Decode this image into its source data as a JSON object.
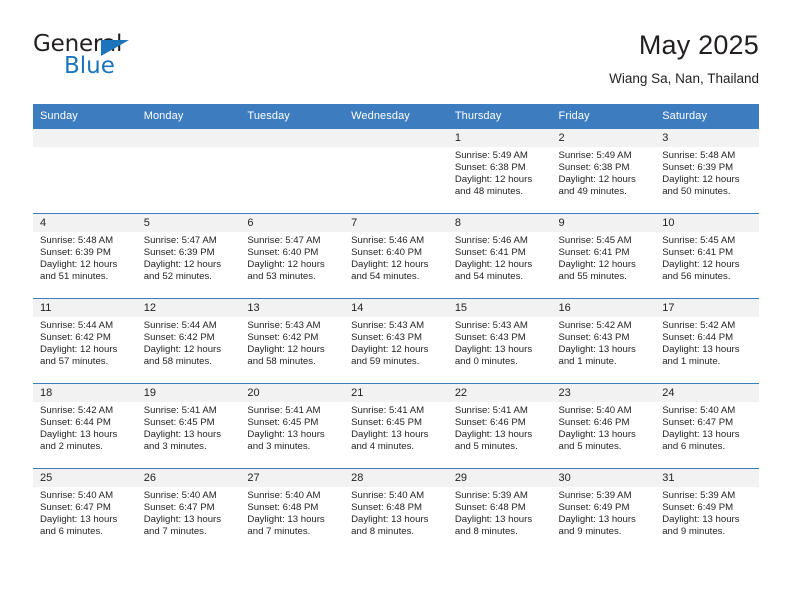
{
  "brand": {
    "logo_text_primary": "General",
    "logo_text_secondary": "Blue",
    "accent_color": "#1c75bc",
    "header_color": "#3c7cbf"
  },
  "header": {
    "title": "May 2025",
    "subtitle": "Wiang Sa, Nan, Thailand"
  },
  "calendar": {
    "weekday_headers": [
      "Sunday",
      "Monday",
      "Tuesday",
      "Wednesday",
      "Thursday",
      "Friday",
      "Saturday"
    ],
    "weeks": [
      [
        {
          "day": "",
          "empty": true
        },
        {
          "day": "",
          "empty": true
        },
        {
          "day": "",
          "empty": true
        },
        {
          "day": "",
          "empty": true
        },
        {
          "day": "1",
          "sunrise": "Sunrise: 5:49 AM",
          "sunset": "Sunset: 6:38 PM",
          "daylight": "Daylight: 12 hours and 48 minutes."
        },
        {
          "day": "2",
          "sunrise": "Sunrise: 5:49 AM",
          "sunset": "Sunset: 6:38 PM",
          "daylight": "Daylight: 12 hours and 49 minutes."
        },
        {
          "day": "3",
          "sunrise": "Sunrise: 5:48 AM",
          "sunset": "Sunset: 6:39 PM",
          "daylight": "Daylight: 12 hours and 50 minutes."
        }
      ],
      [
        {
          "day": "4",
          "sunrise": "Sunrise: 5:48 AM",
          "sunset": "Sunset: 6:39 PM",
          "daylight": "Daylight: 12 hours and 51 minutes."
        },
        {
          "day": "5",
          "sunrise": "Sunrise: 5:47 AM",
          "sunset": "Sunset: 6:39 PM",
          "daylight": "Daylight: 12 hours and 52 minutes."
        },
        {
          "day": "6",
          "sunrise": "Sunrise: 5:47 AM",
          "sunset": "Sunset: 6:40 PM",
          "daylight": "Daylight: 12 hours and 53 minutes."
        },
        {
          "day": "7",
          "sunrise": "Sunrise: 5:46 AM",
          "sunset": "Sunset: 6:40 PM",
          "daylight": "Daylight: 12 hours and 54 minutes."
        },
        {
          "day": "8",
          "sunrise": "Sunrise: 5:46 AM",
          "sunset": "Sunset: 6:41 PM",
          "daylight": "Daylight: 12 hours and 54 minutes."
        },
        {
          "day": "9",
          "sunrise": "Sunrise: 5:45 AM",
          "sunset": "Sunset: 6:41 PM",
          "daylight": "Daylight: 12 hours and 55 minutes."
        },
        {
          "day": "10",
          "sunrise": "Sunrise: 5:45 AM",
          "sunset": "Sunset: 6:41 PM",
          "daylight": "Daylight: 12 hours and 56 minutes."
        }
      ],
      [
        {
          "day": "11",
          "sunrise": "Sunrise: 5:44 AM",
          "sunset": "Sunset: 6:42 PM",
          "daylight": "Daylight: 12 hours and 57 minutes."
        },
        {
          "day": "12",
          "sunrise": "Sunrise: 5:44 AM",
          "sunset": "Sunset: 6:42 PM",
          "daylight": "Daylight: 12 hours and 58 minutes."
        },
        {
          "day": "13",
          "sunrise": "Sunrise: 5:43 AM",
          "sunset": "Sunset: 6:42 PM",
          "daylight": "Daylight: 12 hours and 58 minutes."
        },
        {
          "day": "14",
          "sunrise": "Sunrise: 5:43 AM",
          "sunset": "Sunset: 6:43 PM",
          "daylight": "Daylight: 12 hours and 59 minutes."
        },
        {
          "day": "15",
          "sunrise": "Sunrise: 5:43 AM",
          "sunset": "Sunset: 6:43 PM",
          "daylight": "Daylight: 13 hours and 0 minutes."
        },
        {
          "day": "16",
          "sunrise": "Sunrise: 5:42 AM",
          "sunset": "Sunset: 6:43 PM",
          "daylight": "Daylight: 13 hours and 1 minute."
        },
        {
          "day": "17",
          "sunrise": "Sunrise: 5:42 AM",
          "sunset": "Sunset: 6:44 PM",
          "daylight": "Daylight: 13 hours and 1 minute."
        }
      ],
      [
        {
          "day": "18",
          "sunrise": "Sunrise: 5:42 AM",
          "sunset": "Sunset: 6:44 PM",
          "daylight": "Daylight: 13 hours and 2 minutes."
        },
        {
          "day": "19",
          "sunrise": "Sunrise: 5:41 AM",
          "sunset": "Sunset: 6:45 PM",
          "daylight": "Daylight: 13 hours and 3 minutes."
        },
        {
          "day": "20",
          "sunrise": "Sunrise: 5:41 AM",
          "sunset": "Sunset: 6:45 PM",
          "daylight": "Daylight: 13 hours and 3 minutes."
        },
        {
          "day": "21",
          "sunrise": "Sunrise: 5:41 AM",
          "sunset": "Sunset: 6:45 PM",
          "daylight": "Daylight: 13 hours and 4 minutes."
        },
        {
          "day": "22",
          "sunrise": "Sunrise: 5:41 AM",
          "sunset": "Sunset: 6:46 PM",
          "daylight": "Daylight: 13 hours and 5 minutes."
        },
        {
          "day": "23",
          "sunrise": "Sunrise: 5:40 AM",
          "sunset": "Sunset: 6:46 PM",
          "daylight": "Daylight: 13 hours and 5 minutes."
        },
        {
          "day": "24",
          "sunrise": "Sunrise: 5:40 AM",
          "sunset": "Sunset: 6:47 PM",
          "daylight": "Daylight: 13 hours and 6 minutes."
        }
      ],
      [
        {
          "day": "25",
          "sunrise": "Sunrise: 5:40 AM",
          "sunset": "Sunset: 6:47 PM",
          "daylight": "Daylight: 13 hours and 6 minutes."
        },
        {
          "day": "26",
          "sunrise": "Sunrise: 5:40 AM",
          "sunset": "Sunset: 6:47 PM",
          "daylight": "Daylight: 13 hours and 7 minutes."
        },
        {
          "day": "27",
          "sunrise": "Sunrise: 5:40 AM",
          "sunset": "Sunset: 6:48 PM",
          "daylight": "Daylight: 13 hours and 7 minutes."
        },
        {
          "day": "28",
          "sunrise": "Sunrise: 5:40 AM",
          "sunset": "Sunset: 6:48 PM",
          "daylight": "Daylight: 13 hours and 8 minutes."
        },
        {
          "day": "29",
          "sunrise": "Sunrise: 5:39 AM",
          "sunset": "Sunset: 6:48 PM",
          "daylight": "Daylight: 13 hours and 8 minutes."
        },
        {
          "day": "30",
          "sunrise": "Sunrise: 5:39 AM",
          "sunset": "Sunset: 6:49 PM",
          "daylight": "Daylight: 13 hours and 9 minutes."
        },
        {
          "day": "31",
          "sunrise": "Sunrise: 5:39 AM",
          "sunset": "Sunset: 6:49 PM",
          "daylight": "Daylight: 13 hours and 9 minutes."
        }
      ]
    ]
  }
}
